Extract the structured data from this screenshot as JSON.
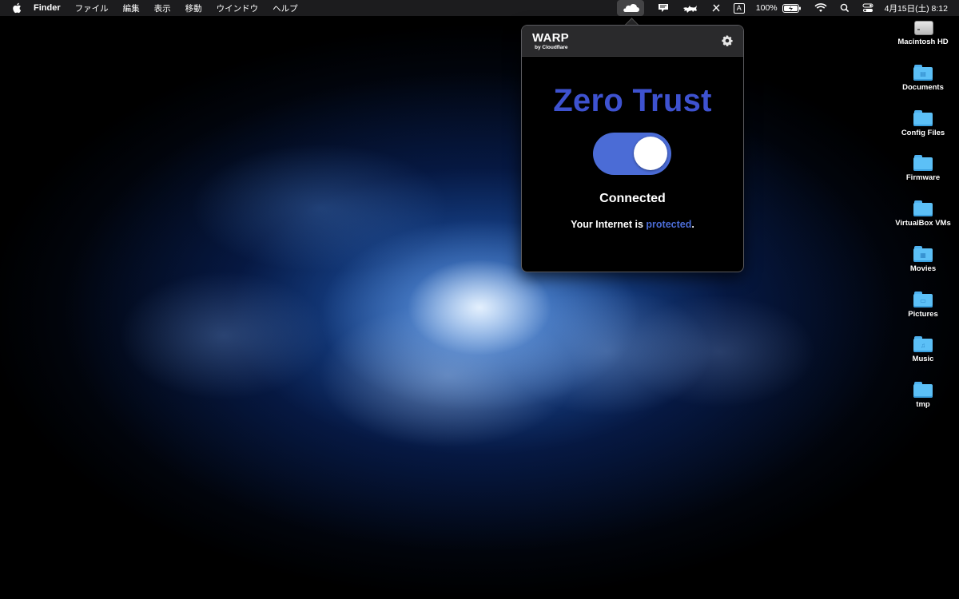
{
  "menubar": {
    "app_name": "Finder",
    "menus": [
      "ファイル",
      "編集",
      "表示",
      "移動",
      "ウインドウ",
      "ヘルプ"
    ],
    "input_mode": "A",
    "battery_percent": "100%",
    "datetime": "4月15日(土)  8:12"
  },
  "warp": {
    "logo_main": "WARP",
    "logo_sub": "by Cloudflare",
    "title": "Zero Trust",
    "status": "Connected",
    "message_prefix": "Your Internet is ",
    "message_highlight": "protected",
    "message_suffix": ".",
    "toggle_on": true,
    "accent_color": "#4b6cd6",
    "title_color": "#3e52d0"
  },
  "desktop": {
    "icons": [
      {
        "label": "Macintosh HD",
        "type": "hard-drive"
      },
      {
        "label": "Documents",
        "type": "folder-documents"
      },
      {
        "label": "Config Files",
        "type": "folder"
      },
      {
        "label": "Firmware",
        "type": "folder"
      },
      {
        "label": "VirtualBox VMs",
        "type": "folder"
      },
      {
        "label": "Movies",
        "type": "folder-movies"
      },
      {
        "label": "Pictures",
        "type": "folder-pictures"
      },
      {
        "label": "Music",
        "type": "folder-music"
      },
      {
        "label": "tmp",
        "type": "folder"
      }
    ]
  }
}
